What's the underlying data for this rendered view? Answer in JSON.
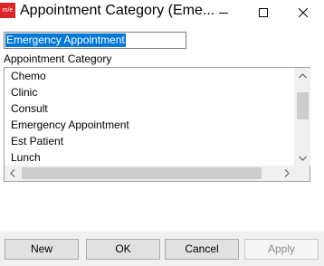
{
  "window": {
    "title": "Appointment Category (Eme...",
    "app_icon_text": "m/e"
  },
  "name_field": {
    "value": "Emergency Appointment"
  },
  "list": {
    "label": "Appointment Category",
    "items": [
      "Chemo",
      "Clinic",
      "Consult",
      "Emergency Appointment",
      "Est Patient",
      "Lunch"
    ]
  },
  "buttons": {
    "new": "New",
    "ok": "OK",
    "cancel": "Cancel",
    "apply": "Apply"
  },
  "colors": {
    "selection": "#0078d7",
    "app_icon": "#d9262b",
    "footer_bg": "#f0f0f0"
  }
}
